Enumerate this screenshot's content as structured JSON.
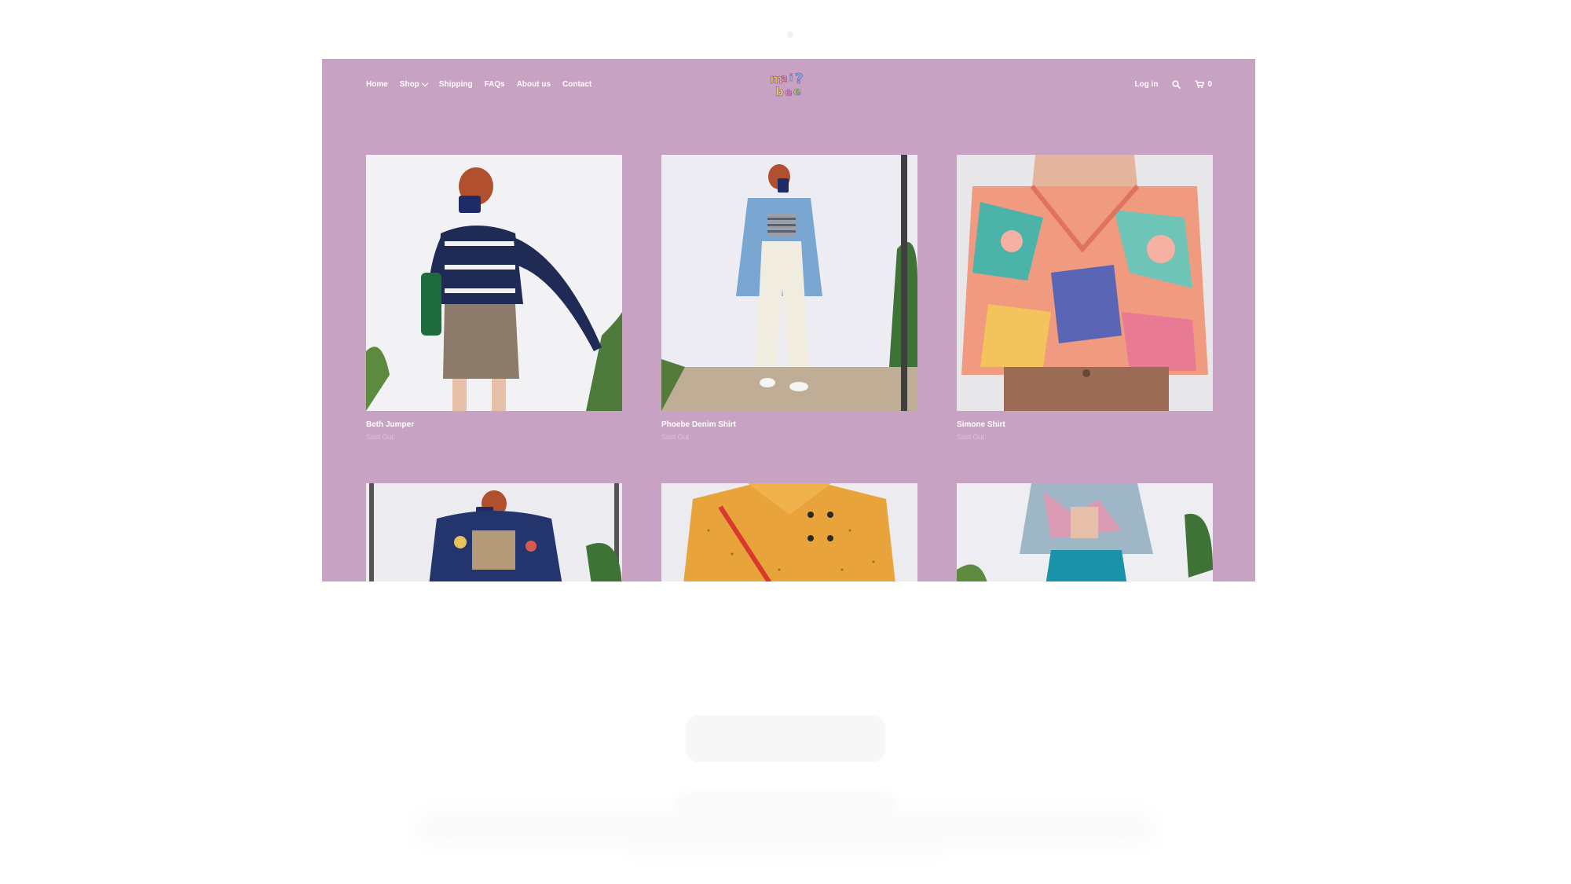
{
  "nav": {
    "items": [
      {
        "label": "Home"
      },
      {
        "label": "Shop",
        "has_dropdown": true
      },
      {
        "label": "Shipping"
      },
      {
        "label": "FAQs"
      },
      {
        "label": "About us"
      },
      {
        "label": "Contact"
      }
    ]
  },
  "header": {
    "login_label": "Log in",
    "cart_count": "0",
    "search_icon": "search-icon",
    "cart_icon": "cart-icon"
  },
  "products": [
    {
      "title": "Beth Jumper",
      "status": "Sold Out"
    },
    {
      "title": "Phoebe Denim Shirt",
      "status": "Sold Out"
    },
    {
      "title": "Simone Shirt",
      "status": "Sold Out"
    },
    {
      "title": "",
      "status": ""
    },
    {
      "title": "",
      "status": ""
    },
    {
      "title": "",
      "status": ""
    }
  ],
  "colors": {
    "panel": "#c8a2c2",
    "text": "#ffffff"
  }
}
